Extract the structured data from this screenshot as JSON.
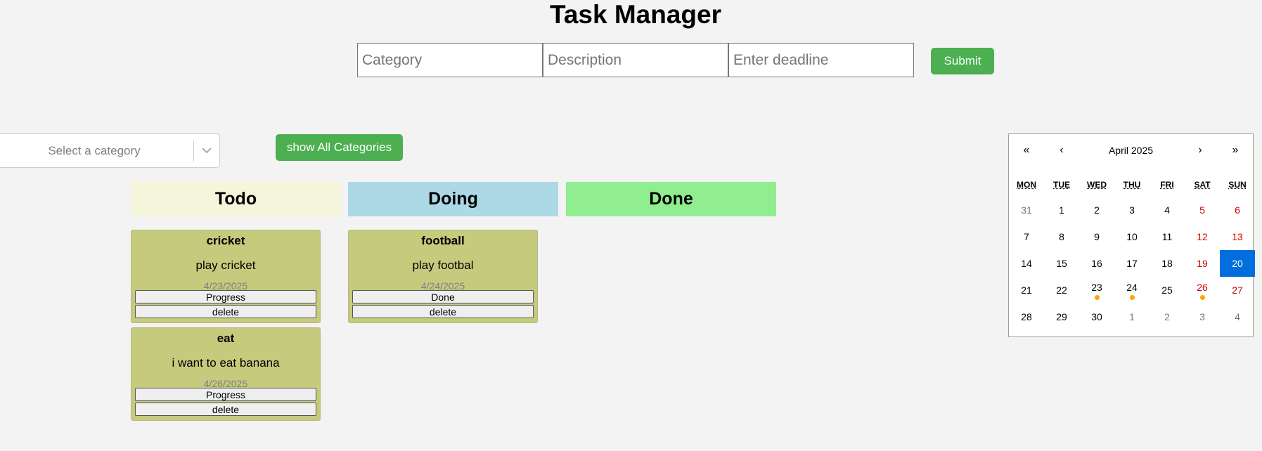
{
  "header": {
    "title": "Task Manager"
  },
  "form": {
    "category_placeholder": "Category",
    "description_placeholder": "Description",
    "deadline_placeholder": "Enter deadline",
    "submit_label": "Submit"
  },
  "filter": {
    "select_placeholder": "Select a category",
    "show_all_label": "show All Categories"
  },
  "columns": [
    {
      "title": "Todo",
      "color": "#f5f5dc"
    },
    {
      "title": "Doing",
      "color": "#add8e6"
    },
    {
      "title": "Done",
      "color": "#90ee90"
    }
  ],
  "tasks": [
    {
      "category": "cricket",
      "description": "play cricket",
      "deadline": "4/23/2025",
      "action": "Progress",
      "delete": "delete"
    },
    {
      "category": "eat",
      "description": "i want to eat banana",
      "deadline": "4/26/2025",
      "action": "Progress",
      "delete": "delete"
    },
    {
      "category": "football",
      "description": "play footbal",
      "deadline": "4/24/2025",
      "action": "Done",
      "delete": "delete"
    }
  ],
  "calendar": {
    "month_label": "April 2025",
    "nav": {
      "prev_year": "«",
      "prev_month": "‹",
      "next_month": "›",
      "next_year": "»"
    },
    "weekdays": [
      "MON",
      "TUE",
      "WED",
      "THU",
      "FRI",
      "SAT",
      "SUN"
    ],
    "days": [
      {
        "d": "31",
        "other": true
      },
      {
        "d": "1"
      },
      {
        "d": "2"
      },
      {
        "d": "3"
      },
      {
        "d": "4"
      },
      {
        "d": "5",
        "weekend": true
      },
      {
        "d": "6",
        "weekend": true
      },
      {
        "d": "7"
      },
      {
        "d": "8"
      },
      {
        "d": "9"
      },
      {
        "d": "10"
      },
      {
        "d": "11"
      },
      {
        "d": "12",
        "weekend": true
      },
      {
        "d": "13",
        "weekend": true
      },
      {
        "d": "14"
      },
      {
        "d": "15"
      },
      {
        "d": "16"
      },
      {
        "d": "17"
      },
      {
        "d": "18"
      },
      {
        "d": "19",
        "weekend": true
      },
      {
        "d": "20",
        "weekend": true,
        "selected": true
      },
      {
        "d": "21"
      },
      {
        "d": "22"
      },
      {
        "d": "23",
        "dot": true
      },
      {
        "d": "24",
        "dot": true
      },
      {
        "d": "25"
      },
      {
        "d": "26",
        "weekend": true,
        "dot": true
      },
      {
        "d": "27",
        "weekend": true
      },
      {
        "d": "28"
      },
      {
        "d": "29"
      },
      {
        "d": "30"
      },
      {
        "d": "1",
        "other": true
      },
      {
        "d": "2",
        "other": true
      },
      {
        "d": "3",
        "other": true
      },
      {
        "d": "4",
        "other": true
      }
    ],
    "colors": {
      "selected": "#006edc",
      "weekend": "#d10000",
      "task_dot": "#ffa500"
    }
  },
  "colors": {
    "accent": "#4caf50",
    "card": "#c5ca7d",
    "background": "#f3f3f3"
  }
}
